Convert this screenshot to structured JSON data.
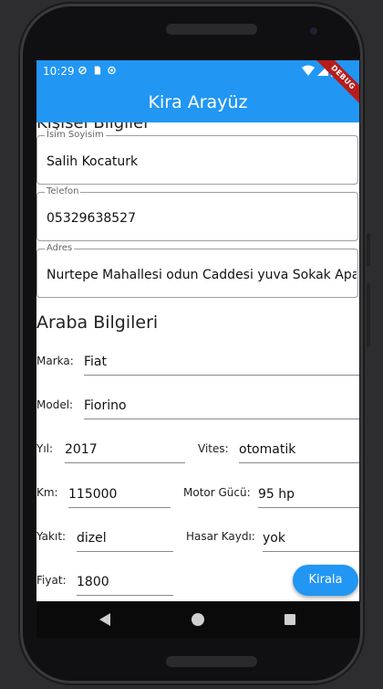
{
  "status_bar": {
    "time": "10:29"
  },
  "app_bar": {
    "title": "Kira Arayüz",
    "debug_badge": "DEBUG"
  },
  "owner_section": {
    "title_partial": "Kişisel Bilgiler",
    "fields": [
      {
        "label": "İsim Soyisim",
        "value": "Salih  Kocaturk"
      },
      {
        "label": "Telefon",
        "value": "05329638527"
      },
      {
        "label": "Adres",
        "value": "Nurtepe Mahallesi odun Caddesi yuva Sokak Apartman"
      }
    ]
  },
  "car_section": {
    "title": "Araba Bilgileri",
    "marka": {
      "label": "Marka:",
      "value": "Fiat"
    },
    "model": {
      "label": "Model:",
      "value": "Fiorino"
    },
    "yil": {
      "label": "Yıl:",
      "value": "2017"
    },
    "vites": {
      "label": "Vites:",
      "value": "otomatik"
    },
    "km": {
      "label": "Km:",
      "value": "115000"
    },
    "motor": {
      "label": "Motor Gücü:",
      "value": "95 hp"
    },
    "yakit": {
      "label": "Yakıt:",
      "value": "dizel"
    },
    "hasar": {
      "label": "Hasar Kaydı:",
      "value": "yok"
    },
    "fiyat": {
      "label": "Fiyat:",
      "value": "1800"
    }
  },
  "actions": {
    "rent_label": "Kirala"
  },
  "colors": {
    "primary": "#2196f3",
    "debug": "#b71c1c"
  }
}
